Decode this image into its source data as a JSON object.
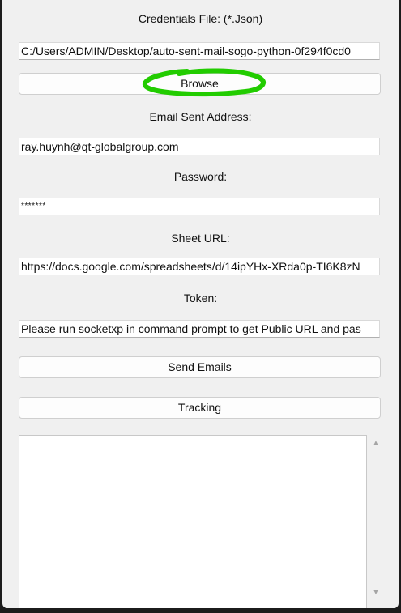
{
  "credentials": {
    "label": "Credentials File: (*.Json)",
    "value": "C:/Users/ADMIN/Desktop/auto-sent-mail-sogo-python-0f294f0cd0",
    "browse_label": "Browse"
  },
  "email": {
    "label": "Email Sent Address:",
    "value": "ray.huynh@qt-globalgroup.com"
  },
  "password": {
    "label": "Password:",
    "value": "*******"
  },
  "sheet": {
    "label": "Sheet URL:",
    "value": "https://docs.google.com/spreadsheets/d/14ipYHx-XRda0p-TI6K8zN"
  },
  "token": {
    "label": "Token:",
    "value": "Please run socketxp in command prompt to get Public URL and pas"
  },
  "actions": {
    "send_label": "Send Emails",
    "tracking_label": "Tracking"
  },
  "output": {
    "value": ""
  },
  "colors": {
    "annotation": "#22cc00",
    "window_bg": "#f0f0f0"
  }
}
